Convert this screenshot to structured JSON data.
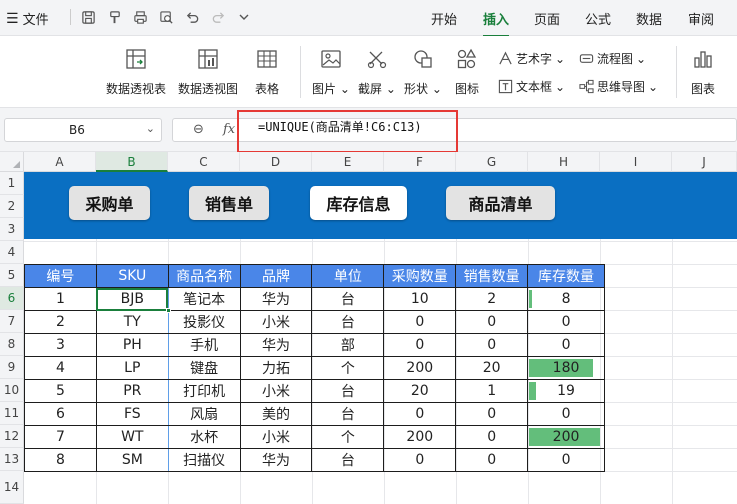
{
  "menubar": {
    "file_label": "文件",
    "tabs": [
      {
        "label": "开始",
        "active": false
      },
      {
        "label": "插入",
        "active": true
      },
      {
        "label": "页面",
        "active": false
      },
      {
        "label": "公式",
        "active": false
      },
      {
        "label": "数据",
        "active": false
      },
      {
        "label": "审阅",
        "active": false
      }
    ]
  },
  "ribbon": {
    "pivot_table": "数据透视表",
    "pivot_chart": "数据透视图",
    "table": "表格",
    "picture": "图片",
    "screenshot": "截屏",
    "shapes": "形状",
    "icons": "图标",
    "wordart": "艺术字",
    "textbox": "文本框",
    "flowchart": "流程图",
    "mindmap": "思维导图",
    "chart": "图表"
  },
  "formula_bar": {
    "name_box": "B6",
    "formula": "=UNIQUE(商品清单!C6:C13)"
  },
  "columns": [
    "A",
    "B",
    "C",
    "D",
    "E",
    "F",
    "G",
    "H",
    "I",
    "J"
  ],
  "rows": [
    "1",
    "2",
    "3",
    "4",
    "5",
    "6",
    "7",
    "8",
    "9",
    "10",
    "11",
    "12",
    "13",
    "14"
  ],
  "nav_buttons": [
    "采购单",
    "销售单",
    "库存信息",
    "商品清单"
  ],
  "table": {
    "headers": [
      "编号",
      "SKU",
      "商品名称",
      "品牌",
      "单位",
      "采购数量",
      "销售数量",
      "库存数量"
    ],
    "rows": [
      [
        "1",
        "BJB",
        "笔记本",
        "华为",
        "台",
        "10",
        "2",
        "8"
      ],
      [
        "2",
        "TY",
        "投影仪",
        "小米",
        "台",
        "0",
        "0",
        "0"
      ],
      [
        "3",
        "PH",
        "手机",
        "华为",
        "部",
        "0",
        "0",
        "0"
      ],
      [
        "4",
        "LP",
        "键盘",
        "力拓",
        "个",
        "200",
        "20",
        "180"
      ],
      [
        "5",
        "PR",
        "打印机",
        "小米",
        "台",
        "20",
        "1",
        "19"
      ],
      [
        "6",
        "FS",
        "风扇",
        "美的",
        "台",
        "0",
        "0",
        "0"
      ],
      [
        "7",
        "WT",
        "水杯",
        "小米",
        "个",
        "200",
        "0",
        "200"
      ],
      [
        "8",
        "SM",
        "扫描仪",
        "华为",
        "台",
        "0",
        "0",
        "0"
      ]
    ],
    "stock_bar_max": 200
  },
  "colors": {
    "accent_green": "#1a7f3c",
    "banner_blue": "#0a6fc2",
    "header_blue": "#4a86e8",
    "databar_green": "#63be7b",
    "highlight_red": "#e53935"
  }
}
